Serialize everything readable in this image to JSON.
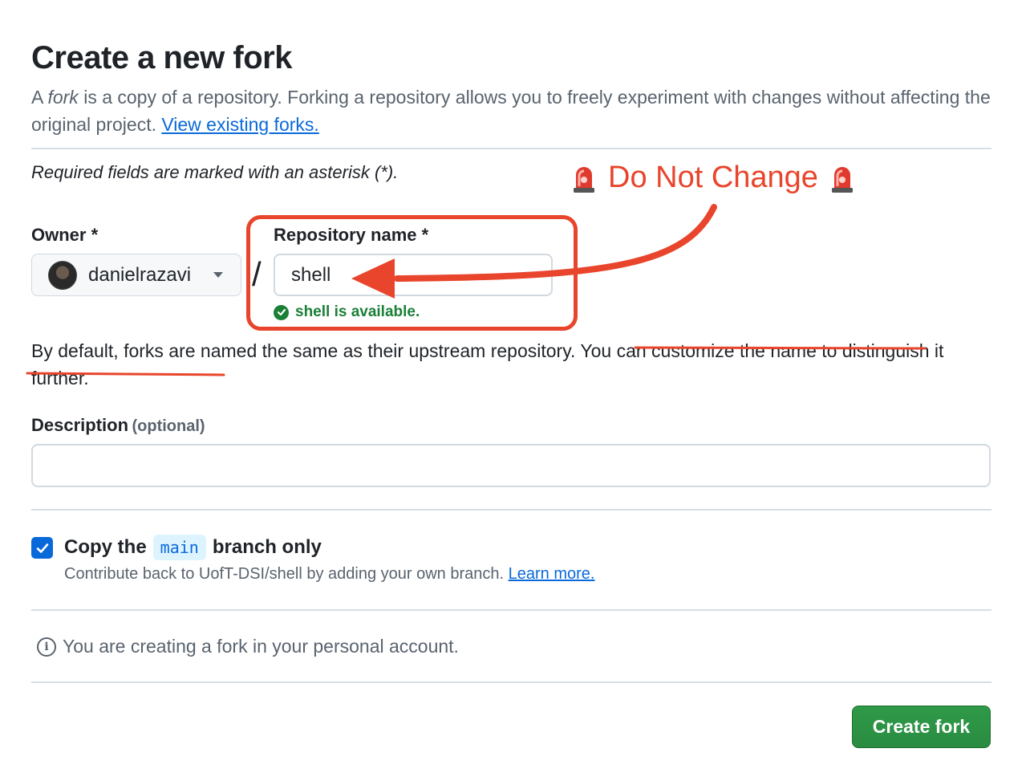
{
  "header": {
    "title": "Create a new fork",
    "intro_prefix": "A ",
    "intro_em": "fork",
    "intro_rest": " is a copy of a repository. Forking a repository allows you to freely experiment with changes without affecting the original project. ",
    "view_forks_link": "View existing forks."
  },
  "form": {
    "required_note": "Required fields are marked with an asterisk (*).",
    "owner_label": "Owner *",
    "owner_value": "danielrazavi",
    "slash": "/",
    "repo_label": "Repository name *",
    "repo_value": "shell",
    "availability": "shell is available.",
    "default_note": "By default, forks are named the same as their upstream repository. ",
    "default_note_struck": "You can customize the name to distinguish it further.",
    "description_label": "Description",
    "description_optional": "(optional)",
    "description_value": "",
    "copy_prefix": "Copy the",
    "copy_branch": "main",
    "copy_suffix": "branch only",
    "copy_checked": true,
    "contrib_text": "Contribute back to UofT-DSI/shell by adding your own branch. ",
    "learn_more_link": "Learn more.",
    "info_text": "You are creating a fork in your personal account.",
    "submit_label": "Create fork"
  },
  "annotation": {
    "label": "Do Not Change",
    "color": "#e8452c"
  },
  "colors": {
    "primary_button": "#2da44e",
    "link": "#0969da",
    "success": "#1a7f37"
  }
}
